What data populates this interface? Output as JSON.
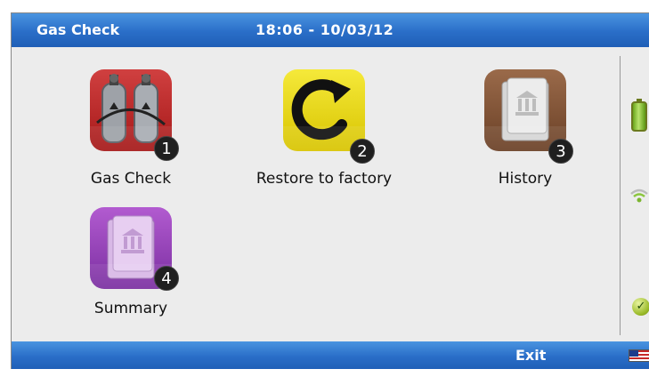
{
  "titlebar": {
    "title": "Gas Check",
    "clock": "18:06 - 10/03/12"
  },
  "tiles": [
    {
      "label": "Gas Check",
      "number": "1",
      "icon": "gas-cylinders-icon",
      "color": "#c02a2a"
    },
    {
      "label": "Restore to factory",
      "number": "2",
      "icon": "refresh-icon",
      "color": "#e8d820"
    },
    {
      "label": "History",
      "number": "3",
      "icon": "archive-book-icon",
      "color": "#7a4e34"
    },
    {
      "label": "Summary",
      "number": "4",
      "icon": "summary-book-icon",
      "color": "#9a3fbd"
    }
  ],
  "status": {
    "battery_icon": "battery-icon",
    "signal_icon": "signal-icon",
    "ok_icon": "check-icon"
  },
  "bottombar": {
    "exit_label": "Exit",
    "language_icon": "us-flag-icon"
  }
}
